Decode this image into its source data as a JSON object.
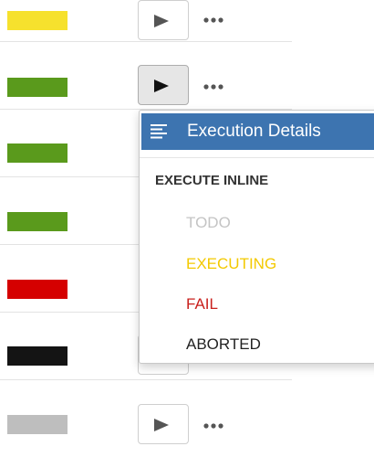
{
  "rows": [
    {
      "status_color": "#f6e12d",
      "button_state": "normal"
    },
    {
      "status_color": "#5a9a1c",
      "button_state": "active"
    },
    {
      "status_color": "#5a9a1c",
      "button_state": "hidden"
    },
    {
      "status_color": "#5a9a1c",
      "button_state": "hidden"
    },
    {
      "status_color": "#d50000",
      "button_state": "hidden"
    },
    {
      "status_color": "#141414",
      "button_state": "hidden"
    },
    {
      "status_color": "#bebebe",
      "button_state": "normal"
    }
  ],
  "menu": {
    "details_label": "Execution Details",
    "details_icon": "lines-icon",
    "section_header": "EXECUTE INLINE",
    "items": [
      {
        "label": "TODO",
        "color": "#c4c4c4"
      },
      {
        "label": "EXECUTING",
        "color": "#f3c900"
      },
      {
        "label": "FAIL",
        "color": "#c9211e"
      },
      {
        "label": "ABORTED",
        "color": "#222222"
      }
    ],
    "highlight_color": "#3d74b0"
  },
  "icons": {
    "play": "play-icon",
    "more": "more-icon"
  }
}
